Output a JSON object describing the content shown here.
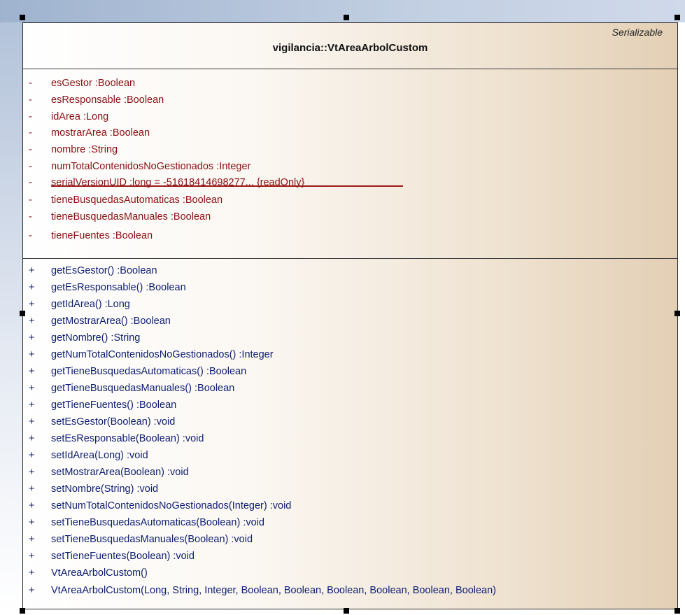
{
  "class": {
    "stereotype": "Serializable",
    "name": "vigilancia::VtAreaArbolCustom"
  },
  "attributes": [
    {
      "visibility": "-",
      "text": "esGestor  :Boolean"
    },
    {
      "visibility": "-",
      "text": "esResponsable  :Boolean"
    },
    {
      "visibility": "-",
      "text": "idArea  :Long"
    },
    {
      "visibility": "-",
      "text": "mostrarArea  :Boolean"
    },
    {
      "visibility": "-",
      "text": "nombre  :String"
    },
    {
      "visibility": "-",
      "text": "numTotalContenidosNoGestionados  :Integer"
    },
    {
      "visibility": "-",
      "text": "serialVersionUID  :long = -51618414698277... {readOnly}"
    },
    {
      "visibility": "-",
      "text": "tieneBusquedasAutomaticas  :Boolean"
    },
    {
      "visibility": "-",
      "text": "tieneBusquedasManuales  :Boolean"
    },
    {
      "visibility": "-",
      "text": "tieneFuentes  :Boolean"
    }
  ],
  "operations": [
    {
      "visibility": "+",
      "text": "getEsGestor()  :Boolean"
    },
    {
      "visibility": "+",
      "text": "getEsResponsable()  :Boolean"
    },
    {
      "visibility": "+",
      "text": "getIdArea()  :Long"
    },
    {
      "visibility": "+",
      "text": "getMostrarArea()  :Boolean"
    },
    {
      "visibility": "+",
      "text": "getNombre()  :String"
    },
    {
      "visibility": "+",
      "text": "getNumTotalContenidosNoGestionados()  :Integer"
    },
    {
      "visibility": "+",
      "text": "getTieneBusquedasAutomaticas()  :Boolean"
    },
    {
      "visibility": "+",
      "text": "getTieneBusquedasManuales()  :Boolean"
    },
    {
      "visibility": "+",
      "text": "getTieneFuentes()  :Boolean"
    },
    {
      "visibility": "+",
      "text": "setEsGestor(Boolean)  :void"
    },
    {
      "visibility": "+",
      "text": "setEsResponsable(Boolean)  :void"
    },
    {
      "visibility": "+",
      "text": "setIdArea(Long)  :void"
    },
    {
      "visibility": "+",
      "text": "setMostrarArea(Boolean)  :void"
    },
    {
      "visibility": "+",
      "text": "setNombre(String)  :void"
    },
    {
      "visibility": "+",
      "text": "setNumTotalContenidosNoGestionados(Integer)  :void"
    },
    {
      "visibility": "+",
      "text": "setTieneBusquedasAutomaticas(Boolean)  :void"
    },
    {
      "visibility": "+",
      "text": "setTieneBusquedasManuales(Boolean)  :void"
    },
    {
      "visibility": "+",
      "text": "setTieneFuentes(Boolean)  :void"
    },
    {
      "visibility": "+",
      "text": "VtAreaArbolCustom()"
    },
    {
      "visibility": "+",
      "text": "VtAreaArbolCustom(Long, String, Integer, Boolean, Boolean, Boolean, Boolean, Boolean, Boolean)"
    }
  ],
  "colors": {
    "attribute_text": "#8a0f13",
    "operation_text": "#0d1e72",
    "class_fill": "#eee1cf",
    "selection_band": "#b3c3da"
  }
}
